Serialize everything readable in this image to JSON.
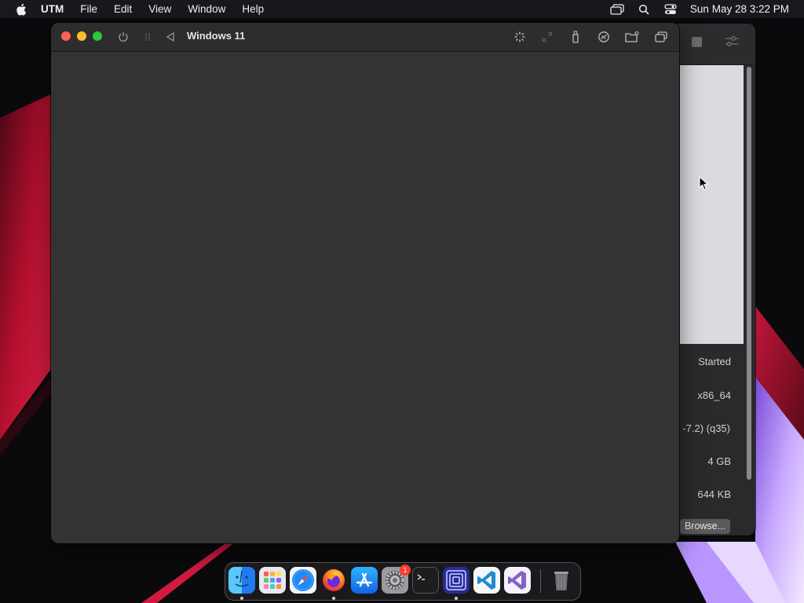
{
  "menubar": {
    "app_name": "UTM",
    "items": [
      "File",
      "Edit",
      "View",
      "Window",
      "Help"
    ],
    "clock": "Sun May 28  3:22 PM"
  },
  "vm_window": {
    "title": "Windows 11",
    "toolbar_icons": [
      "power-icon",
      "pause-icon",
      "restart-icon",
      "capture-input-icon",
      "resize-icon",
      "usb-icon",
      "drive-icon",
      "shared-folder-icon",
      "windows-icon"
    ]
  },
  "bg_window": {
    "status": "Started",
    "architecture": "x86_64",
    "machine": "-7.2) (q35)",
    "memory": "4 GB",
    "size": "644 KB",
    "browse_label": "Browse..."
  },
  "dock": {
    "apps": [
      "Finder",
      "Launchpad",
      "Safari",
      "Firefox",
      "App Store",
      "System Settings",
      "Terminal",
      "UTM",
      "Visual Studio Code",
      "Visual Studio",
      "Trash"
    ],
    "badge_count": "1"
  },
  "colors": {
    "close": "#fe5f57",
    "minimize": "#febc2e",
    "zoom": "#28c840",
    "vm_display": "#333333"
  }
}
